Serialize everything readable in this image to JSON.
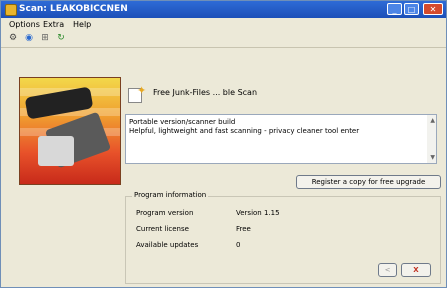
{
  "window": {
    "title": "Scan: LEAKOBICCNEN",
    "buttons": {
      "minimize": "_",
      "maximize": "□",
      "close": "✕"
    }
  },
  "menu": [
    "Options",
    "Extra",
    "Help"
  ],
  "toolbar": {
    "icons": [
      "settings-icon",
      "scan-icon",
      "network-icon",
      "refresh-icon"
    ]
  },
  "banner": {
    "heading": "Free Junk-Files ... ble Scan",
    "description": "Portable version/scanner build\nHelpful, lightweight and fast scanning - privacy cleaner tool enter"
  },
  "register_button": "Register a copy for free upgrade",
  "info": {
    "title": "Program information",
    "rows": [
      {
        "label": "Program version",
        "value": "Version 1.15"
      },
      {
        "label": "Current license",
        "value": "Free"
      },
      {
        "label": "Available updates",
        "value": "0"
      }
    ]
  },
  "nav": {
    "back": "<",
    "next": "X"
  },
  "colors": {
    "titlebar": "#1c4fb8",
    "accent_red": "#c03020",
    "window_bg": "#ece9d8"
  }
}
